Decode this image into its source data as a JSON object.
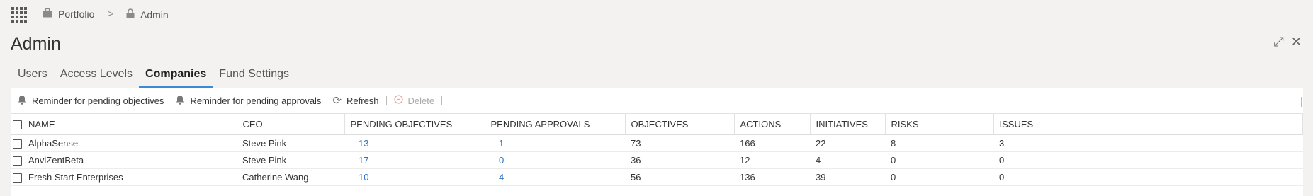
{
  "breadcrumb": {
    "items": [
      {
        "label": "Portfolio",
        "icon": "briefcase-icon"
      },
      {
        "label": "Admin",
        "icon": "lock-icon"
      }
    ],
    "separator": ">"
  },
  "page": {
    "title": "Admin"
  },
  "tabs": [
    {
      "label": "Users",
      "active": false
    },
    {
      "label": "Access Levels",
      "active": false
    },
    {
      "label": "Companies",
      "active": true
    },
    {
      "label": "Fund Settings",
      "active": false
    }
  ],
  "toolbar": {
    "reminder_objectives": "Reminder for pending objectives",
    "reminder_approvals": "Reminder for pending approvals",
    "refresh": "Refresh",
    "delete": "Delete"
  },
  "table": {
    "columns": [
      "NAME",
      "CEO",
      "PENDING OBJECTIVES",
      "PENDING APPROVALS",
      "OBJECTIVES",
      "ACTIONS",
      "INITIATIVES",
      "RISKS",
      "ISSUES"
    ],
    "rows": [
      {
        "name": "AlphaSense",
        "ceo": "Steve Pink",
        "pending_objectives": "13",
        "pending_approvals": "1",
        "objectives": "73",
        "actions": "166",
        "initiatives": "22",
        "risks": "8",
        "issues": "3"
      },
      {
        "name": "AnviZentBeta",
        "ceo": "Steve Pink",
        "pending_objectives": "17",
        "pending_approvals": "0",
        "objectives": "36",
        "actions": "12",
        "initiatives": "4",
        "risks": "0",
        "issues": "0"
      },
      {
        "name": "Fresh Start Enterprises",
        "ceo": "Catherine Wang",
        "pending_objectives": "10",
        "pending_approvals": "4",
        "objectives": "56",
        "actions": "136",
        "initiatives": "39",
        "risks": "0",
        "issues": "0"
      }
    ]
  },
  "colors": {
    "accent": "#3c8ad6",
    "link": "#2a72c2",
    "background": "#f3f2f1"
  }
}
